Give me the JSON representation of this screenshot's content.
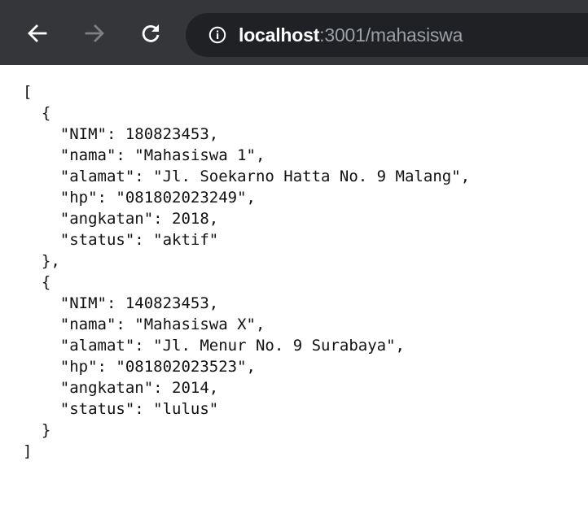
{
  "browser": {
    "toolbar_bg": "#35363a",
    "omnibox_bg": "#202124",
    "url_host": "localhost",
    "url_rest": ":3001/mahasiswa",
    "icons": {
      "back": "arrow-left-icon",
      "forward": "arrow-right-icon",
      "reload": "reload-icon",
      "info": "info-icon"
    }
  },
  "json_lines": [
    "[",
    "  {",
    "    \"NIM\": 180823453,",
    "    \"nama\": \"Mahasiswa 1\",",
    "    \"alamat\": \"Jl. Soekarno Hatta No. 9 Malang\",",
    "    \"hp\": \"081802023249\",",
    "    \"angkatan\": 2018,",
    "    \"status\": \"aktif\"",
    "  },",
    "  {",
    "    \"NIM\": 140823453,",
    "    \"nama\": \"Mahasiswa X\",",
    "    \"alamat\": \"Jl. Menur No. 9 Surabaya\",",
    "    \"hp\": \"081802023523\",",
    "    \"angkatan\": 2014,",
    "    \"status\": \"lulus\"",
    "  }",
    "]"
  ]
}
